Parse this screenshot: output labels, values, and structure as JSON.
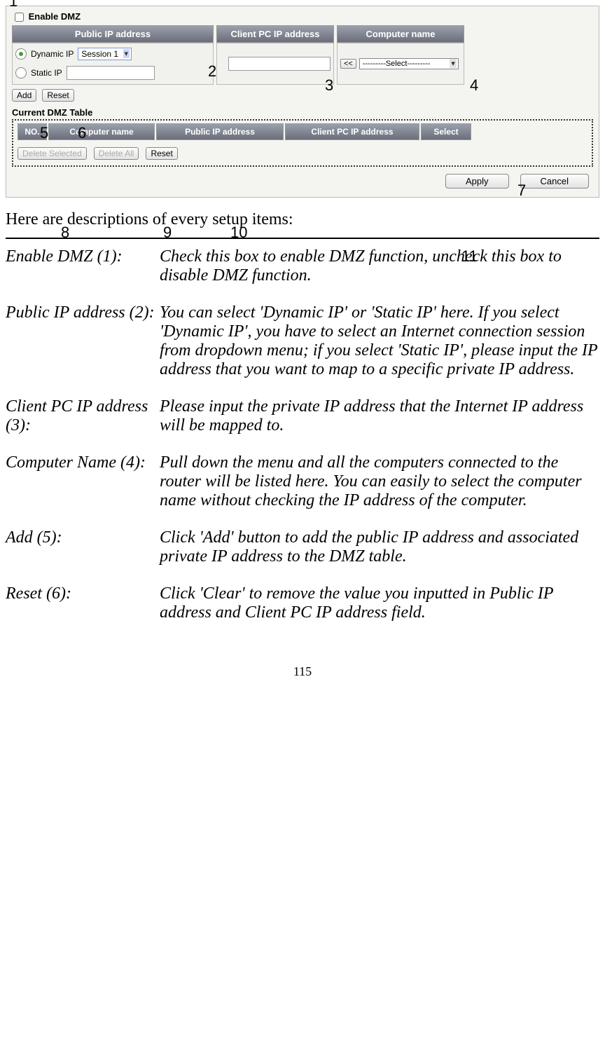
{
  "screenshot": {
    "enable_label": "Enable DMZ",
    "headers": {
      "c1": "Public IP address",
      "c2": "Client PC IP address",
      "c3": "Computer name"
    },
    "dynamic_label": "Dynamic IP",
    "static_label": "Static IP",
    "session_value": "Session 1",
    "comp_select": "---------Select---------",
    "add_btn": "Add",
    "reset_btn": "Reset",
    "dmz_title": "Current DMZ Table",
    "dmz_headers": {
      "no": "NO.",
      "cn": "Computer name",
      "pub": "Public IP address",
      "cli": "Client PC IP address",
      "sel": "Select"
    },
    "del_sel": "Delete Selected",
    "del_all": "Delete All",
    "reset2": "Reset",
    "apply": "Apply",
    "cancel": "Cancel"
  },
  "annotations": {
    "a1": "1",
    "a2": "2",
    "a3": "3",
    "a4": "4",
    "a5": "5",
    "a6": "6",
    "a7": "7",
    "a8": "8",
    "a9": "9",
    "a10": "10",
    "a11": "11"
  },
  "intro": "Here are descriptions of every setup items:",
  "items": {
    "i1": {
      "label": "Enable DMZ (1):",
      "text": "Check this box to enable DMZ function, uncheck this box to disable DMZ function."
    },
    "i2": {
      "label": "Public IP address (2):",
      "text": "You can select 'Dynamic IP' or 'Static IP' here. If you select 'Dynamic IP', you have to select an Internet connection session from dropdown menu; if you select 'Static IP', please input the IP address that you want to map to a specific private IP address."
    },
    "i3": {
      "label": "Client PC IP address (3):",
      "text": "Please input the private IP address that the Internet IP address will be mapped to."
    },
    "i4": {
      "label": "Computer Name (4):",
      "text": "Pull down the menu and all the computers connected to the router will be listed here. You can easily to select the computer name without checking the IP address of the computer."
    },
    "i5": {
      "label": "Add (5):",
      "text": "Click 'Add' button to add the public IP address and associated private IP address to the DMZ table."
    },
    "i6": {
      "label": "Reset (6):",
      "text": "Click 'Clear' to remove the value you inputted in Public IP address and Client PC IP address field."
    }
  },
  "pagenum": "115"
}
